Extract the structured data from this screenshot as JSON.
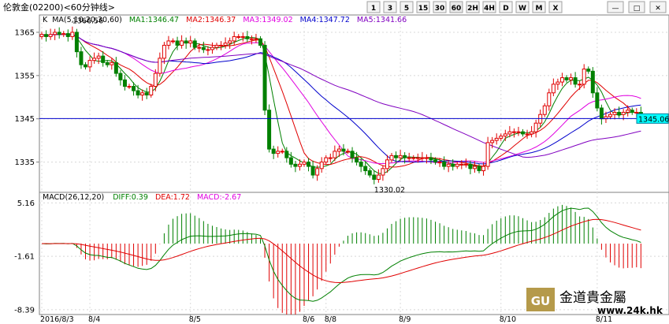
{
  "title": "伦敦金(02200)<60分钟线>",
  "toolbar": {
    "timeframes": [
      "1",
      "3",
      "5",
      "15",
      "30",
      "60",
      "2H",
      "4H",
      "D",
      "W",
      "M",
      "X"
    ],
    "active": "60"
  },
  "window_controls": [
    "minimize",
    "maximize",
    "close"
  ],
  "ma_legend": {
    "prefix": "K",
    "params": "MA(5,10,20,30,60)",
    "items": [
      {
        "label": "MA1:1346.47",
        "color": "#008000"
      },
      {
        "label": "MA2:1346.37",
        "color": "#e00000"
      },
      {
        "label": "MA3:1349.02",
        "color": "#e000e0"
      },
      {
        "label": "MA4:1347.72",
        "color": "#0000cc"
      },
      {
        "label": "MA5:1341.66",
        "color": "#8000c0"
      }
    ]
  },
  "macd_legend": {
    "items": [
      {
        "label": "MACD(26,12,20)",
        "color": "#000000"
      },
      {
        "label": "DIFF:0.39",
        "color": "#008000"
      },
      {
        "label": "DEA:1.72",
        "color": "#e00000"
      },
      {
        "label": "MACD:-2.67",
        "color": "#e000e0"
      }
    ]
  },
  "price_axis": {
    "ticks": [
      1365,
      1355,
      1345,
      1335
    ],
    "labels": [
      "1365",
      "1355",
      "1345",
      "1335"
    ]
  },
  "macd_axis": {
    "ticks": [
      5.16,
      -1.61,
      -8.39
    ],
    "labels": [
      "5.16",
      "-1.61",
      "-8.39"
    ]
  },
  "current_price": "1345.06",
  "annotations": [
    {
      "text": "1366.56",
      "idx": 7,
      "value": 1366.56,
      "where": "above"
    },
    {
      "text": "1330.02",
      "idx": 76,
      "value": 1330.02,
      "where": "below"
    }
  ],
  "dates": [
    {
      "label": "2016/8/3",
      "idx": 0
    },
    {
      "label": "8/4",
      "idx": 11
    },
    {
      "label": "8/5",
      "idx": 34
    },
    {
      "label": "8/6",
      "idx": 60
    },
    {
      "label": "8/8",
      "idx": 65
    },
    {
      "label": "8/9",
      "idx": 82
    },
    {
      "label": "8/10",
      "idx": 105
    },
    {
      "label": "8/11",
      "idx": 127
    }
  ],
  "watermark": {
    "logo": "GU",
    "name": "金道貴金屬",
    "url": "www.24k.hk"
  },
  "colors": {
    "up": "#e00000",
    "down": "#008000",
    "axis": "#808080",
    "grid": "#c0c0c0",
    "current_line": "#0000cc",
    "current_label_bg": "#00ffff"
  },
  "chart_data": {
    "type": "candlestick",
    "series_name": "伦敦金(02200)",
    "closes": [
      1364.5,
      1364.0,
      1364.5,
      1365.0,
      1364.5,
      1364.7,
      1364.0,
      1365.0,
      1360.5,
      1357.5,
      1357.0,
      1358.5,
      1359.0,
      1359.5,
      1358.0,
      1357.5,
      1358.0,
      1355.5,
      1354.0,
      1352.5,
      1352.5,
      1351.5,
      1350.5,
      1351.0,
      1350.5,
      1352.5,
      1355.5,
      1359.0,
      1362.0,
      1363.0,
      1363.0,
      1362.0,
      1363.0,
      1362.5,
      1363.0,
      1361.5,
      1361.5,
      1361.0,
      1361.0,
      1361.5,
      1362.0,
      1362.0,
      1362.5,
      1363.0,
      1364.0,
      1364.0,
      1364.0,
      1363.5,
      1363.5,
      1363.5,
      1362.0,
      1347.0,
      1338.0,
      1337.0,
      1337.5,
      1337.5,
      1336.0,
      1334.5,
      1334.0,
      1334.5,
      1335.0,
      1334.0,
      1332.0,
      1333.5,
      1335.0,
      1336.0,
      1336.0,
      1337.5,
      1338.0,
      1337.5,
      1337.5,
      1336.0,
      1335.0,
      1334.0,
      1333.0,
      1332.0,
      1331.0,
      1332.0,
      1333.5,
      1335.5,
      1336.5,
      1336.0,
      1336.5,
      1336.0,
      1336.0,
      1336.0,
      1336.0,
      1336.0,
      1336.0,
      1335.5,
      1335.0,
      1335.0,
      1334.0,
      1334.5,
      1334.0,
      1334.5,
      1334.5,
      1334.5,
      1333.5,
      1334.0,
      1333.0,
      1334.0,
      1339.5,
      1340.0,
      1340.5,
      1341.0,
      1341.5,
      1342.0,
      1342.0,
      1342.0,
      1341.5,
      1341.5,
      1342.0,
      1344.0,
      1346.0,
      1348.0,
      1351.0,
      1353.0,
      1353.5,
      1354.5,
      1354.0,
      1354.5,
      1353.0,
      1353.0,
      1356.5,
      1356.0,
      1351.0,
      1347.5,
      1345.0,
      1345.5,
      1346.0,
      1346.5,
      1346.0,
      1346.5,
      1347.0,
      1346.5,
      1346.5,
      1345.06
    ],
    "highs_ref": {
      "max": 1366.56,
      "min": 1330.02
    },
    "ma": {
      "MA1": 1346.47,
      "MA2": 1346.37,
      "MA3": 1349.02,
      "MA4": 1347.72,
      "MA5": 1341.66
    },
    "macd": {
      "DIFF": 0.39,
      "DEA": 1.72,
      "MACD": -2.67
    },
    "y_price_range": [
      1328,
      1369
    ],
    "y_macd_range": [
      -9,
      6.5
    ]
  }
}
